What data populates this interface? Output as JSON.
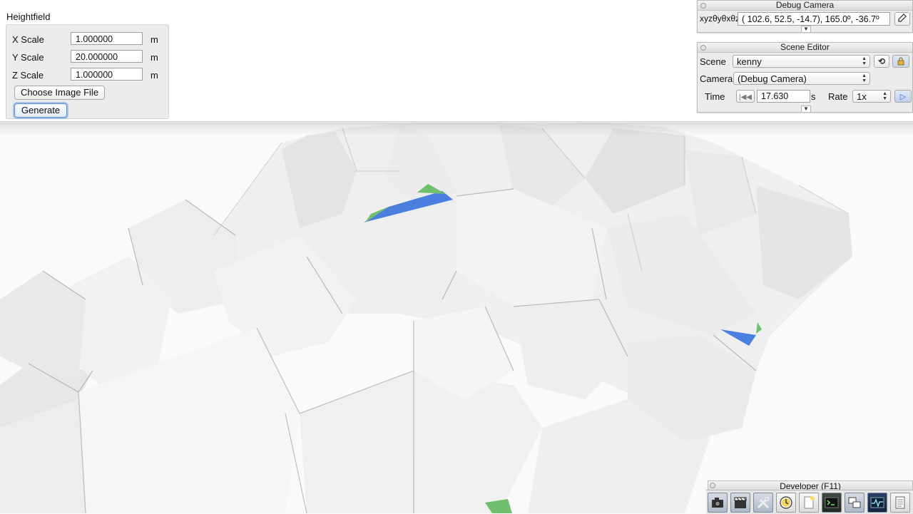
{
  "heightfield": {
    "title": "Heightfield",
    "rows": [
      {
        "label": "X Scale",
        "value": "1.000000",
        "unit": "m"
      },
      {
        "label": "Y Scale",
        "value": "20.000000",
        "unit": "m"
      },
      {
        "label": "Z Scale",
        "value": "1.000000",
        "unit": "m"
      }
    ],
    "choose_button": "Choose Image File",
    "generate_button": "Generate"
  },
  "debug_camera": {
    "title": "Debug Camera",
    "field_label": "xyzθyθxθz",
    "value": "( 102.6,  52.5, -14.7),  165.0º, -36.7º",
    "pick_icon": "camera-pick-icon"
  },
  "scene_editor": {
    "title": "Scene Editor",
    "scene_label": "Scene",
    "scene_value": "kenny",
    "camera_label": "Camera",
    "camera_value": "(Debug Camera)",
    "time_label": "Time",
    "time_value": "17.630",
    "time_unit": "s",
    "rate_label": "Rate",
    "rate_value": "1x",
    "reload_icon": "reload-icon",
    "lock_icon": "lock-icon",
    "play_icon": "play-icon",
    "rewind_icon": "rewind-icon"
  },
  "developer": {
    "title": "Developer (F11)",
    "tools": [
      "camera-icon",
      "clapperboard-icon",
      "tools-icon",
      "clock-icon",
      "new-file-icon",
      "terminal-icon",
      "windows-icon",
      "profiler-icon",
      "document-icon"
    ]
  },
  "colors": {
    "accent_blue": "#4a7fe0",
    "accent_green": "#6fbf6f",
    "panel": "#ececec"
  }
}
